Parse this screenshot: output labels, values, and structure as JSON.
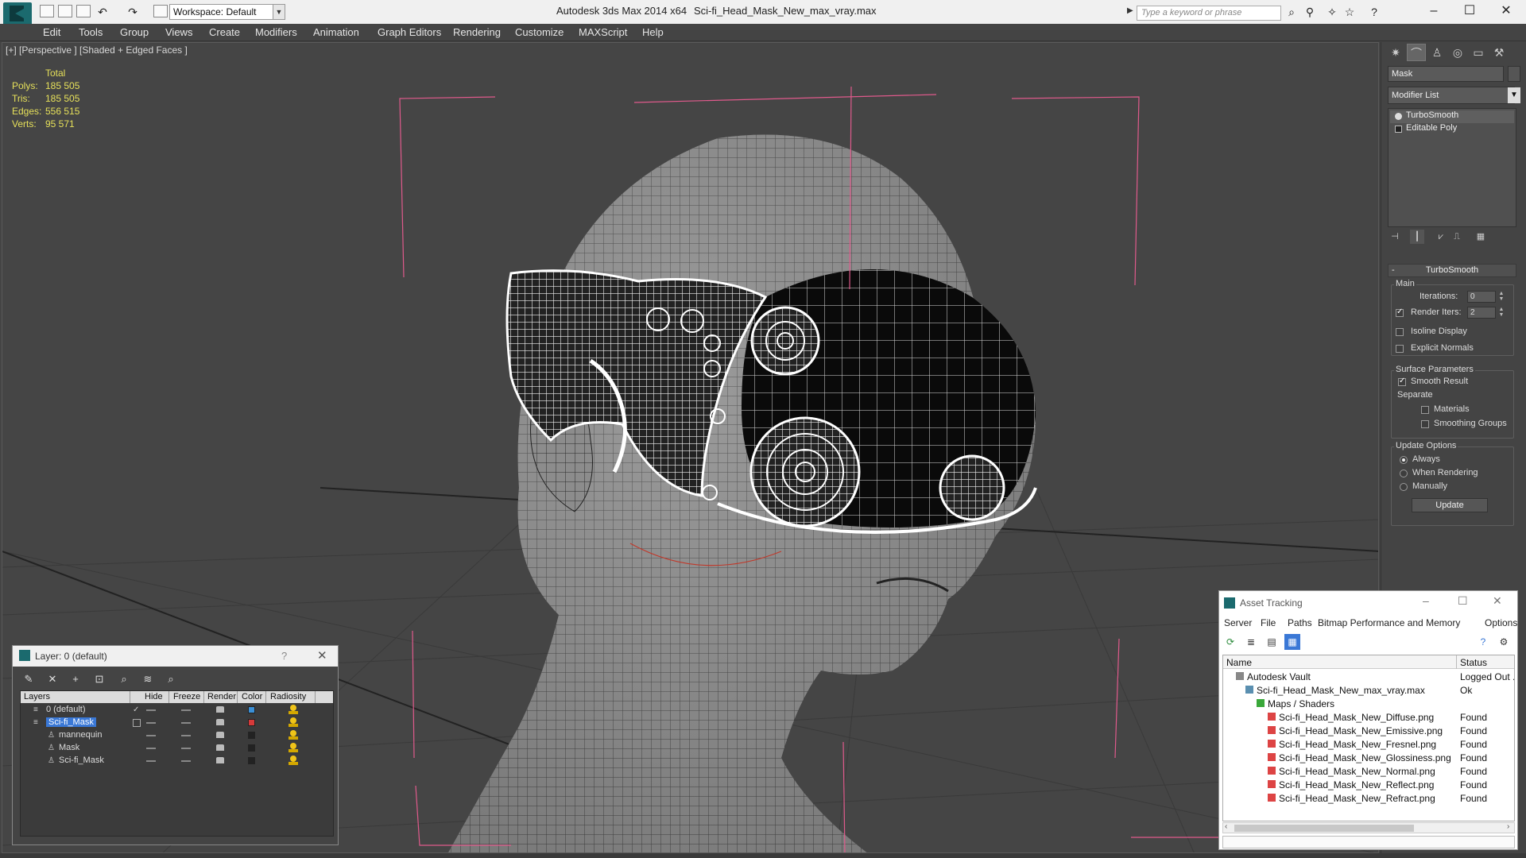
{
  "titlebar": {
    "workspace": "Workspace: Default",
    "app_title": "Autodesk 3ds Max  2014 x64",
    "file_title": "Sci-fi_Head_Mask_New_max_vray.max",
    "search_placeholder": "Type a keyword or phrase",
    "icons": [
      "binoculars-icon",
      "search-icon",
      "star-icon",
      "help-icon"
    ]
  },
  "menu": [
    "Edit",
    "Tools",
    "Group",
    "Views",
    "Create",
    "Modifiers",
    "Animation",
    "Graph Editors",
    "Rendering",
    "Customize",
    "MAXScript",
    "Help"
  ],
  "viewport": {
    "label": "[+] [Perspective ] [Shaded + Edged Faces ]",
    "stats": {
      "header": "Total",
      "rows": [
        {
          "k": "Polys:",
          "v": "185 505"
        },
        {
          "k": "Tris:",
          "v": "185 505"
        },
        {
          "k": "Edges:",
          "v": "556 515"
        },
        {
          "k": "Verts:",
          "v": "95 571"
        }
      ]
    }
  },
  "command_panel": {
    "object_name": "Mask",
    "modifier_list": "Modifier List",
    "stack": [
      "TurboSmooth",
      "Editable Poly"
    ],
    "rollout_title": "TurboSmooth",
    "main_label": "Main",
    "iterations_label": "Iterations:",
    "iterations_value": "0",
    "render_iters_label": "Render Iters:",
    "render_iters_value": "2",
    "render_iters_checked": true,
    "isoline_label": "Isoline Display",
    "explicit_normals_label": "Explicit Normals",
    "surface_params_label": "Surface Parameters",
    "smooth_result_label": "Smooth Result",
    "separate_label": "Separate",
    "materials_label": "Materials",
    "smoothing_groups_label": "Smoothing Groups",
    "update_options_label": "Update Options",
    "always_label": "Always",
    "when_rendering_label": "When Rendering",
    "manually_label": "Manually",
    "update_button": "Update"
  },
  "layer_dialog": {
    "title": "Layer: 0 (default)",
    "help": "?",
    "columns": [
      "Layers",
      "Hide",
      "Freeze",
      "Render",
      "Color",
      "Radiosity"
    ],
    "rows": [
      {
        "name": "0 (default)",
        "color": "#3a8fd6",
        "indent": 0,
        "selected": false,
        "current": true
      },
      {
        "name": "Sci-fi_Mask",
        "color": "#d63a3a",
        "indent": 0,
        "selected": true,
        "current": false
      },
      {
        "name": "mannequin",
        "color": "#222222",
        "indent": 1,
        "selected": false,
        "current": false
      },
      {
        "name": "Mask",
        "color": "#222222",
        "indent": 1,
        "selected": false,
        "current": false
      },
      {
        "name": "Sci-fi_Mask",
        "color": "#222222",
        "indent": 1,
        "selected": false,
        "current": false
      }
    ]
  },
  "asset_tracking": {
    "title": "Asset Tracking",
    "menu": [
      "Server",
      "File",
      "Paths",
      "Bitmap Performance and Memory",
      "Options"
    ],
    "columns": [
      "Name",
      "Status"
    ],
    "rows": [
      {
        "name": "Autodesk Vault",
        "status": "Logged Out ...",
        "level": 0,
        "icon": "vault"
      },
      {
        "name": "Sci-fi_Head_Mask_New_max_vray.max",
        "status": "Ok",
        "level": 1,
        "icon": "file"
      },
      {
        "name": "Maps / Shaders",
        "status": "",
        "level": 2,
        "icon": "folder"
      },
      {
        "name": "Sci-fi_Head_Mask_New_Diffuse.png",
        "status": "Found",
        "level": 3,
        "icon": "png"
      },
      {
        "name": "Sci-fi_Head_Mask_New_Emissive.png",
        "status": "Found",
        "level": 3,
        "icon": "png"
      },
      {
        "name": "Sci-fi_Head_Mask_New_Fresnel.png",
        "status": "Found",
        "level": 3,
        "icon": "png"
      },
      {
        "name": "Sci-fi_Head_Mask_New_Glossiness.png",
        "status": "Found",
        "level": 3,
        "icon": "png"
      },
      {
        "name": "Sci-fi_Head_Mask_New_Normal.png",
        "status": "Found",
        "level": 3,
        "icon": "png"
      },
      {
        "name": "Sci-fi_Head_Mask_New_Reflect.png",
        "status": "Found",
        "level": 3,
        "icon": "png"
      },
      {
        "name": "Sci-fi_Head_Mask_New_Refract.png",
        "status": "Found",
        "level": 3,
        "icon": "png"
      }
    ]
  },
  "colors": {
    "stats_yellow": "#e6e05a",
    "selection_blue": "#3a78d6",
    "bracket_pink": "#e05a8c",
    "app_teal": "#1b6a6e"
  }
}
